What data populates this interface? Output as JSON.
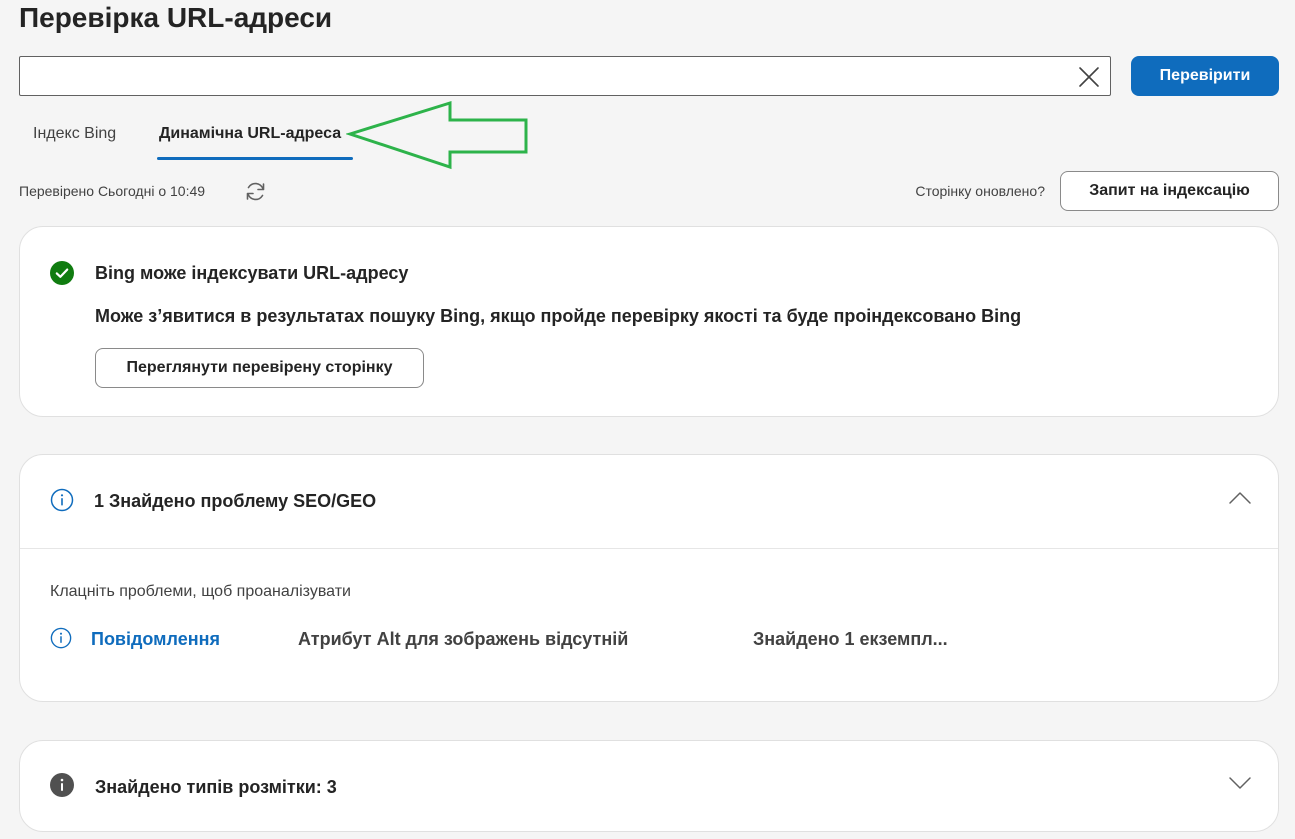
{
  "page": {
    "title": "Перевірка URL-адреси"
  },
  "search": {
    "value": "",
    "placeholder": "",
    "check_label": "Перевірити"
  },
  "tabs": [
    {
      "label": "Індекс Bing",
      "active": false
    },
    {
      "label": "Динамічна URL-адреса",
      "active": true
    }
  ],
  "status_bar": {
    "checked_text": "Перевірено Сьогодні о 10:49",
    "updated_question": "Сторінку оновлено?",
    "index_request_label": "Запит на індексацію"
  },
  "indexability": {
    "title": "Bing може індексувати URL-адресу",
    "description": "Може з’явитися в результатах пошуку Bing, якщо пройде перевірку якості та буде проіндексовано Bing",
    "view_button_label": "Переглянути перевірену сторінку",
    "status_color": "#107c10",
    "status_icon": "checkmark-circle-icon"
  },
  "seo_issues": {
    "heading": "1 Знайдено проблему SEO/GEO",
    "expanded": true,
    "hint": "Клацніть проблеми, щоб проаналізувати",
    "issues": [
      {
        "type": "Повідомлення",
        "name": "Атрибут Alt для зображень відсутній",
        "count": "Знайдено 1 екземпл..."
      }
    ]
  },
  "markup": {
    "heading": "Знайдено типів розмітки: 3",
    "expanded": false
  },
  "colors": {
    "accent": "#0f6cbd",
    "annotation_arrow": "#2db34a",
    "background": "#f5f5f5"
  }
}
